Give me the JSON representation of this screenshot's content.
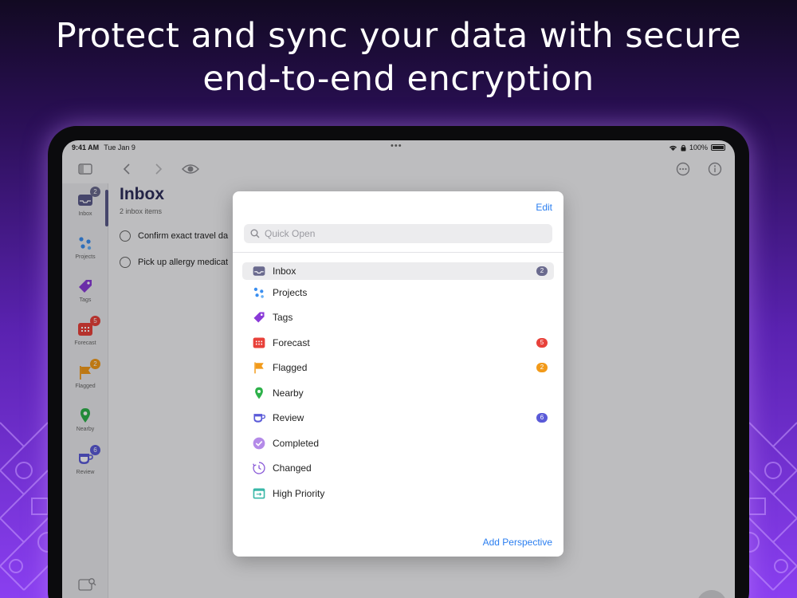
{
  "headline": {
    "line1": "Protect and sync your data with secure",
    "line2": "end-to-end encryption"
  },
  "status": {
    "time": "9:41 AM",
    "date": "Tue Jan 9",
    "dots": "•••",
    "battery": "100%"
  },
  "sidebar": {
    "items": [
      {
        "label": "Inbox",
        "badge": "2"
      },
      {
        "label": "Projects",
        "badge": ""
      },
      {
        "label": "Tags",
        "badge": ""
      },
      {
        "label": "Forecast",
        "badge": "5"
      },
      {
        "label": "Flagged",
        "badge": "2"
      },
      {
        "label": "Nearby",
        "badge": ""
      },
      {
        "label": "Review",
        "badge": "6"
      }
    ]
  },
  "main": {
    "title": "Inbox",
    "subtitle": "2 inbox items",
    "tasks": [
      {
        "text": "Confirm exact travel da"
      },
      {
        "text": "Pick up allergy medicat"
      }
    ],
    "fab": "+"
  },
  "modal": {
    "edit_label": "Edit",
    "search_placeholder": "Quick Open",
    "items": [
      {
        "label": "Inbox",
        "badge": "2",
        "icon": "inbox-icon"
      },
      {
        "label": "Projects",
        "badge": "",
        "icon": "projects-icon"
      },
      {
        "label": "Tags",
        "badge": "",
        "icon": "tag-icon"
      },
      {
        "label": "Forecast",
        "badge": "5",
        "icon": "calendar-icon"
      },
      {
        "label": "Flagged",
        "badge": "2",
        "icon": "flag-icon"
      },
      {
        "label": "Nearby",
        "badge": "",
        "icon": "location-pin-icon"
      },
      {
        "label": "Review",
        "badge": "6",
        "icon": "review-cup-icon"
      },
      {
        "label": "Completed",
        "badge": "",
        "icon": "checkmark-icon"
      },
      {
        "label": "Changed",
        "badge": "",
        "icon": "clock-icon"
      },
      {
        "label": "High Priority",
        "badge": "",
        "icon": "custom-perspective-icon"
      }
    ],
    "add_label": "Add Perspective"
  },
  "colors": {
    "accent": "#2a7ef0",
    "inbox_badge": "#6a6a8e",
    "forecast_badge": "#e8413a",
    "flagged_badge": "#f29a1a",
    "review_badge": "#5a5ad8"
  }
}
